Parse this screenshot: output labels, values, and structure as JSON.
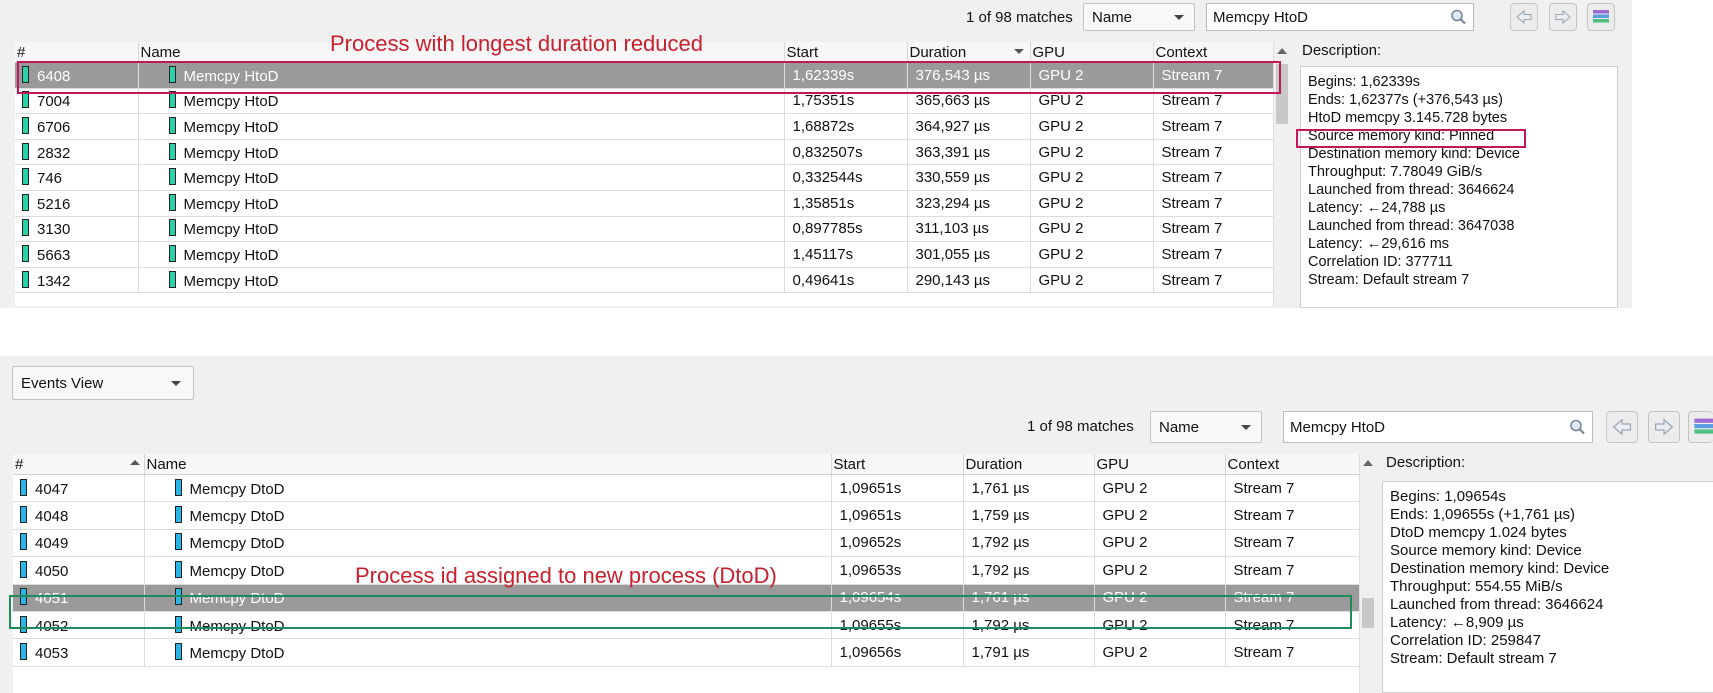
{
  "colors": {
    "annotation_red": "#c8202e",
    "highlight_crimson": "#c2185b",
    "highlight_green": "#1f8a5c",
    "htod_bar": "#2ad1a8",
    "dtod_bar": "#29b6e6",
    "selection_row": "#9a9a9a"
  },
  "top": {
    "toolbar": {
      "matches": "1 of 98 matches",
      "filter_field": "Name",
      "search_value": "Memcpy HtoD"
    },
    "annotation": "Process with longest duration reduced",
    "columns": [
      "#",
      "Name",
      "Start",
      "Duration",
      "GPU",
      "Context"
    ],
    "rows": [
      {
        "id": "6408",
        "name": "Memcpy HtoD",
        "start": "1,62339s",
        "duration": "376,543 µs",
        "gpu": "GPU 2",
        "context": "Stream 7"
      },
      {
        "id": "7004",
        "name": "Memcpy HtoD",
        "start": "1,75351s",
        "duration": "365,663 µs",
        "gpu": "GPU 2",
        "context": "Stream 7"
      },
      {
        "id": "6706",
        "name": "Memcpy HtoD",
        "start": "1,68872s",
        "duration": "364,927 µs",
        "gpu": "GPU 2",
        "context": "Stream 7"
      },
      {
        "id": "2832",
        "name": "Memcpy HtoD",
        "start": "0,832507s",
        "duration": "363,391 µs",
        "gpu": "GPU 2",
        "context": "Stream 7"
      },
      {
        "id": "746",
        "name": "Memcpy HtoD",
        "start": "0,332544s",
        "duration": "330,559 µs",
        "gpu": "GPU 2",
        "context": "Stream 7"
      },
      {
        "id": "5216",
        "name": "Memcpy HtoD",
        "start": "1,35851s",
        "duration": "323,294 µs",
        "gpu": "GPU 2",
        "context": "Stream 7"
      },
      {
        "id": "3130",
        "name": "Memcpy HtoD",
        "start": "0,897785s",
        "duration": "311,103 µs",
        "gpu": "GPU 2",
        "context": "Stream 7"
      },
      {
        "id": "5663",
        "name": "Memcpy HtoD",
        "start": "1,45117s",
        "duration": "301,055 µs",
        "gpu": "GPU 2",
        "context": "Stream 7"
      },
      {
        "id": "1342",
        "name": "Memcpy HtoD",
        "start": "0,49641s",
        "duration": "290,143 µs",
        "gpu": "GPU 2",
        "context": "Stream 7"
      }
    ],
    "description_label": "Description:",
    "description": [
      "Begins: 1,62339s",
      "Ends: 1,62377s (+376,543 µs)",
      "HtoD memcpy 3.145.728 bytes",
      "Source memory kind: Pinned",
      "Destination memory kind: Device",
      "Throughput: 7.78049 GiB/s",
      "Launched from thread: 3646624",
      "Latency: ←24,788 µs",
      "Launched from thread: 3647038",
      "Latency: ←29,616 ms",
      "Correlation ID: 377711",
      "Stream: Default stream 7"
    ]
  },
  "bottom": {
    "view_select": "Events View",
    "toolbar": {
      "matches": "1 of 98 matches",
      "filter_field": "Name",
      "search_value": "Memcpy HtoD"
    },
    "annotation": "Process id assigned to new process (DtoD)",
    "columns": [
      "#",
      "Name",
      "Start",
      "Duration",
      "GPU",
      "Context"
    ],
    "rows": [
      {
        "id": "4047",
        "name": "Memcpy DtoD",
        "start": "1,09651s",
        "duration": "1,761 µs",
        "gpu": "GPU 2",
        "context": "Stream 7"
      },
      {
        "id": "4048",
        "name": "Memcpy DtoD",
        "start": "1,09651s",
        "duration": "1,759 µs",
        "gpu": "GPU 2",
        "context": "Stream 7"
      },
      {
        "id": "4049",
        "name": "Memcpy DtoD",
        "start": "1,09652s",
        "duration": "1,792 µs",
        "gpu": "GPU 2",
        "context": "Stream 7"
      },
      {
        "id": "4050",
        "name": "Memcpy DtoD",
        "start": "1,09653s",
        "duration": "1,792 µs",
        "gpu": "GPU 2",
        "context": "Stream 7"
      },
      {
        "id": "4051",
        "name": "Memcpy DtoD",
        "start": "1,09654s",
        "duration": "1,761 µs",
        "gpu": "GPU 2",
        "context": "Stream 7"
      },
      {
        "id": "4052",
        "name": "Memcpy DtoD",
        "start": "1,09655s",
        "duration": "1,792 µs",
        "gpu": "GPU 2",
        "context": "Stream 7"
      },
      {
        "id": "4053",
        "name": "Memcpy DtoD",
        "start": "1,09656s",
        "duration": "1,791 µs",
        "gpu": "GPU 2",
        "context": "Stream 7"
      }
    ],
    "description_label": "Description:",
    "description": [
      "Begins: 1,09654s",
      "Ends: 1,09655s (+1,761 µs)",
      "DtoD memcpy 1.024 bytes",
      "Source memory kind: Device",
      "Destination memory kind: Device",
      "Throughput: 554.55 MiB/s",
      "Launched from thread: 3646624",
      "Latency: ←8,909 µs",
      "Correlation ID: 259847",
      "Stream: Default stream 7"
    ]
  }
}
